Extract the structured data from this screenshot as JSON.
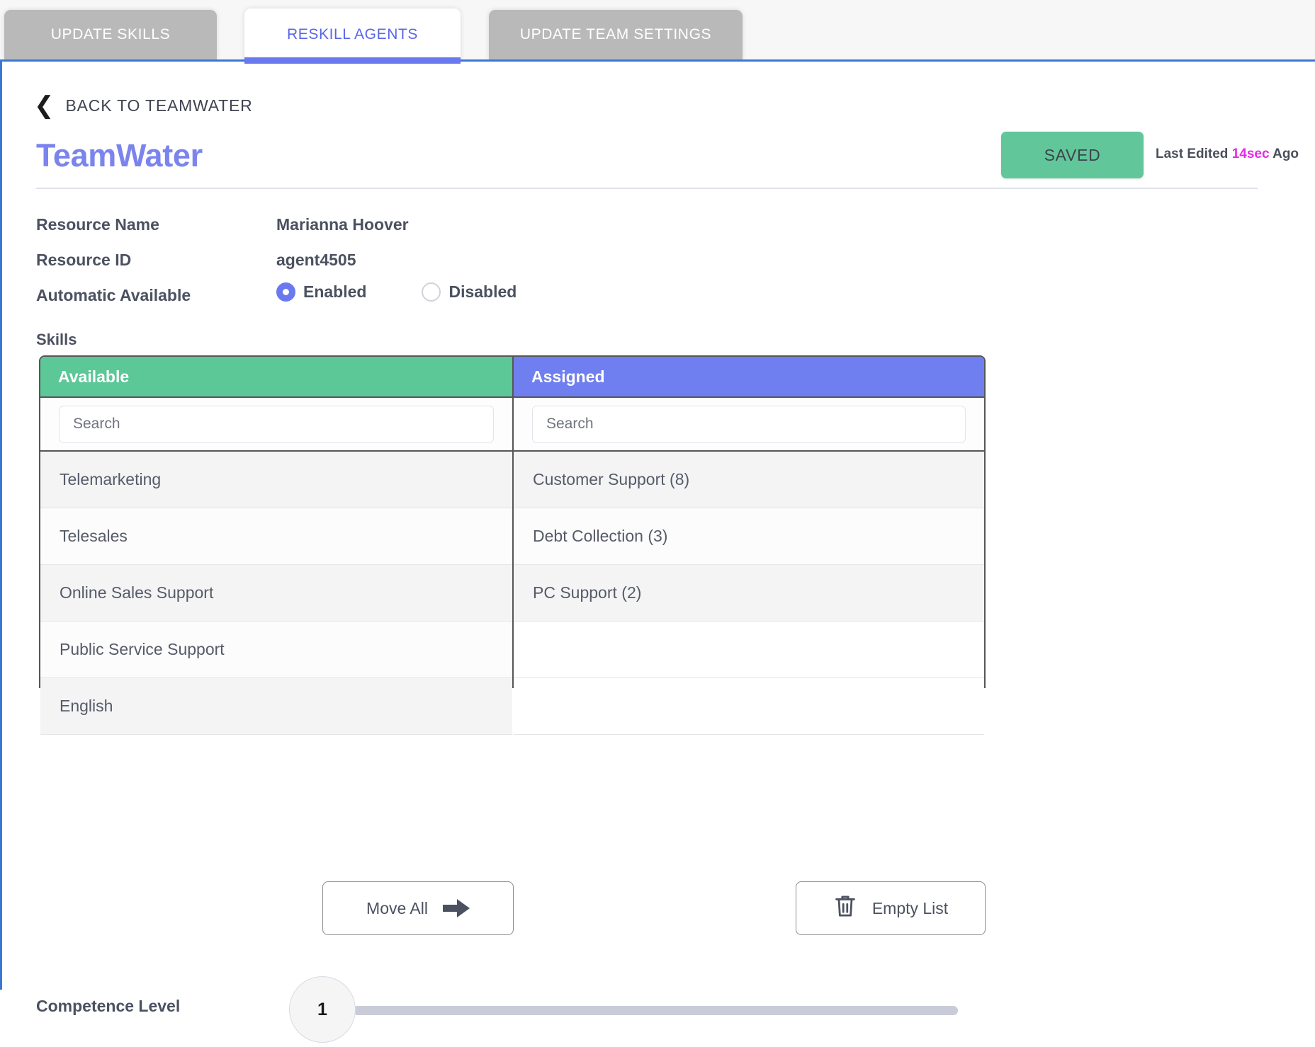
{
  "tabs": [
    {
      "label": "UPDATE SKILLS",
      "active": false
    },
    {
      "label": "RESKILL AGENTS",
      "active": true
    },
    {
      "label": "UPDATE TEAM SETTINGS",
      "active": false
    }
  ],
  "back_link": {
    "label": "BACK TO TEAMWATER",
    "icon": "chevron-left-icon"
  },
  "header": {
    "title": "TeamWater",
    "save_button_label": "SAVED",
    "last_edited_prefix": "Last Edited ",
    "last_edited_value": "14sec",
    "last_edited_suffix": " Ago"
  },
  "fields": {
    "resource_name_label": "Resource Name",
    "resource_name_value": "Marianna Hoover",
    "resource_id_label": "Resource ID",
    "resource_id_value": "agent4505",
    "automatic_available_label": "Automatic Available",
    "radio_enabled_label": "Enabled",
    "radio_disabled_label": "Disabled",
    "radio_selected": "Enabled"
  },
  "skills": {
    "section_label": "Skills",
    "available": {
      "header": "Available",
      "search_placeholder": "Search",
      "search_value": "",
      "items": [
        "Telemarketing",
        "Telesales",
        "Online Sales Support",
        "Public Service Support",
        "English"
      ]
    },
    "assigned": {
      "header": "Assigned",
      "search_placeholder": "Search",
      "search_value": "",
      "items": [
        "Customer Support (8)",
        "Debt Collection (3)",
        "PC Support (2)"
      ]
    },
    "move_all_label": "Move All",
    "move_all_icon": "arrow-right-icon",
    "empty_list_label": "Empty List",
    "empty_list_icon": "trash-icon"
  },
  "competence": {
    "label": "Competence Level",
    "value": "1",
    "min": 1,
    "max": 10
  },
  "colors": {
    "accent_purple": "#707fef",
    "accent_green": "#5cc797",
    "title_purple": "#7b84ed",
    "highlight_magenta": "#e42ae4",
    "tab_inactive": "#b9b9b9",
    "rule_blue": "#3b77d4"
  }
}
